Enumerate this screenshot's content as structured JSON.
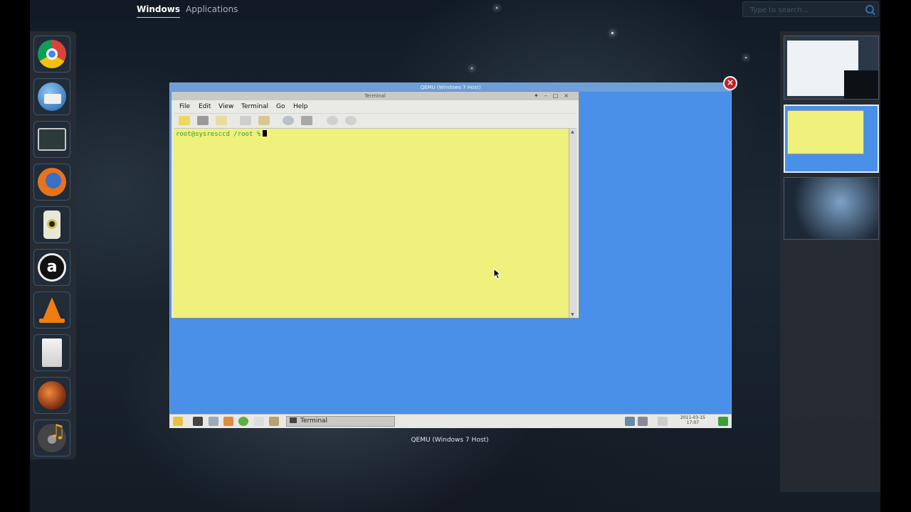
{
  "overview": {
    "tabs": [
      {
        "label": "Windows",
        "active": true
      },
      {
        "label": "Applications",
        "active": false
      }
    ],
    "search": {
      "placeholder": "Type to search...",
      "value": ""
    }
  },
  "dash": {
    "items": [
      {
        "name": "chrome"
      },
      {
        "name": "thunderbird"
      },
      {
        "name": "terminal"
      },
      {
        "name": "firefox"
      },
      {
        "name": "speaker"
      },
      {
        "name": "amarok"
      },
      {
        "name": "vlc"
      },
      {
        "name": "files"
      },
      {
        "name": "bird-app"
      },
      {
        "name": "music"
      }
    ]
  },
  "qemu_window": {
    "title": "QEMU (Windows 7 Host)",
    "caption": "QEMU (Windows 7 Host)",
    "close_glyph": "×"
  },
  "terminal_window": {
    "title": "Terminal",
    "menu": [
      "File",
      "Edit",
      "View",
      "Terminal",
      "Go",
      "Help"
    ],
    "prompt": "root@sysresccd /root %"
  },
  "guest_panel": {
    "task_label": "Terminal",
    "clock_date": "2011-03-15",
    "clock_time": "17:07"
  },
  "colors": {
    "guest_desktop": "#4a8fe8",
    "terminal_bg": "#f0f07c",
    "prompt": "#2e9e2e"
  }
}
